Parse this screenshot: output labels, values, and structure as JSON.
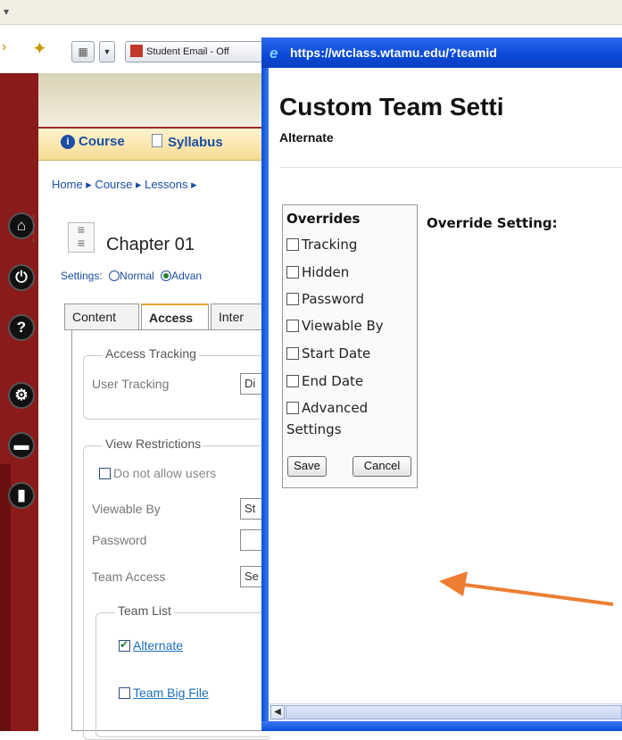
{
  "browser": {
    "tab_label": "Student Email - Off"
  },
  "course_page": {
    "nav": [
      "Course",
      "Syllabus"
    ],
    "breadcrumb": "Home ▸ Course ▸ Lessons ▸",
    "chapter_title": "Chapter 01",
    "settings_label": "Settings:",
    "settings_normal": "Normal",
    "settings_advanced": "Advan",
    "tabs": [
      "Content",
      "Access",
      "Inter"
    ],
    "access_tracking": {
      "legend": "Access Tracking",
      "user_tracking_label": "User Tracking",
      "user_tracking_value": "Di"
    },
    "view_restrictions": {
      "legend": "View Restrictions",
      "do_not_allow": "Do not allow users",
      "viewable_by_label": "Viewable By",
      "viewable_by_value": "St",
      "password_label": "Password",
      "team_access_label": "Team Access",
      "team_access_value": "Se"
    },
    "team_list": {
      "legend": "Team List",
      "teams": [
        {
          "name": "Alternate",
          "checked": true
        },
        {
          "name": "Team Big File",
          "checked": false
        }
      ]
    }
  },
  "popup": {
    "url": "https://wtclass.wtamu.edu/?teamid",
    "heading": "Custom Team Setti",
    "subheading": "Alternate",
    "overrides_title": "Overrides",
    "overrides": [
      {
        "label": "Tracking",
        "checked": false
      },
      {
        "label": "Hidden",
        "checked": false
      },
      {
        "label": "Password",
        "checked": false
      },
      {
        "label": "Viewable By",
        "checked": false
      },
      {
        "label": "Start Date",
        "checked": false
      },
      {
        "label": "End Date",
        "checked": false
      },
      {
        "label": "Advanced",
        "checked": false
      }
    ],
    "overrides_wrap": "Settings",
    "save_label": "Save",
    "cancel_label": "Cancel",
    "override_settings_label": "Override Setting:"
  },
  "annotation": {
    "arrow_color": "#ed7d31"
  }
}
